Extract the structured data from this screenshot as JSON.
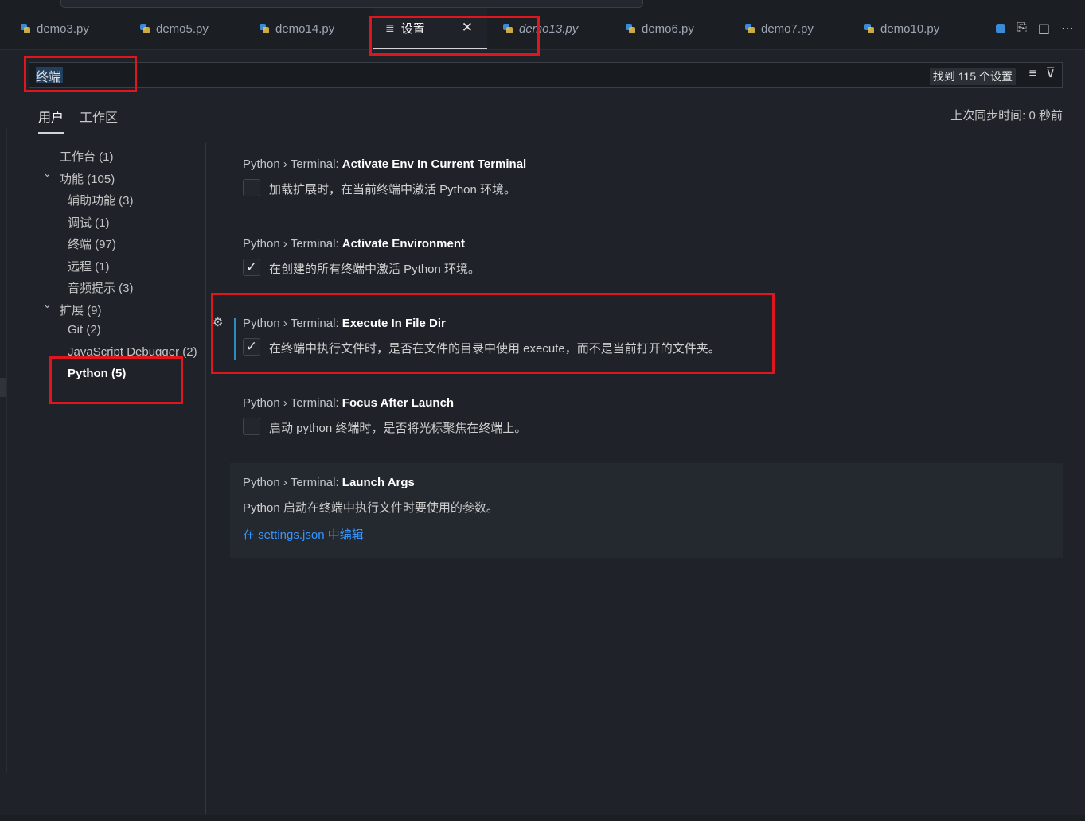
{
  "tabs": [
    {
      "label": "demo3.py",
      "icon": "python-file-icon"
    },
    {
      "label": "demo5.py",
      "icon": "python-file-icon"
    },
    {
      "label": "demo14.py",
      "icon": "python-file-icon"
    },
    {
      "label": "设置",
      "icon": "settings-file-icon",
      "active": true,
      "close": "✕"
    },
    {
      "label": "demo13.py",
      "icon": "python-file-icon",
      "italic": true
    },
    {
      "label": "demo6.py",
      "icon": "python-file-icon"
    },
    {
      "label": "demo7.py",
      "icon": "python-file-icon"
    },
    {
      "label": "demo10.py",
      "icon": "python-file-icon"
    }
  ],
  "search": {
    "value": "终端",
    "result_count": "找到 115 个设置"
  },
  "scope": {
    "user": "用户",
    "workspace": "工作区",
    "sync": "上次同步时间: 0 秒前"
  },
  "toc": [
    {
      "label": "工作台 (1)"
    },
    {
      "label": "功能 (105)",
      "expanded": true
    },
    {
      "label": "辅助功能 (3)"
    },
    {
      "label": "调试 (1)"
    },
    {
      "label": "终端 (97)"
    },
    {
      "label": "远程 (1)"
    },
    {
      "label": "音频提示 (3)"
    },
    {
      "label": "扩展 (9)",
      "expanded": true
    },
    {
      "label": "Git (2)"
    },
    {
      "label": "JavaScript Debugger (2)"
    },
    {
      "label": "Python (5)",
      "selected": true
    }
  ],
  "settings": [
    {
      "prefix": "Python › Terminal: ",
      "name": "Activate Env In Current Terminal",
      "desc": "加载扩展时，在当前终端中激活 Python 环境。",
      "checked": false
    },
    {
      "prefix": "Python › Terminal: ",
      "name": "Activate Environment",
      "desc": "在创建的所有终端中激活 Python 环境。",
      "checked": true
    },
    {
      "prefix": "Python › Terminal: ",
      "name": "Execute In File Dir",
      "desc": "在终端中执行文件时，是否在文件的目录中使用 execute，而不是当前打开的文件夹。",
      "checked": true
    },
    {
      "prefix": "Python › Terminal: ",
      "name": "Focus After Launch",
      "desc": "启动 python 终端时，是否将光标聚焦在终端上。",
      "checked": false
    },
    {
      "prefix": "Python › Terminal: ",
      "name": "Launch Args",
      "desc": "Python 启动在终端中执行文件时要使用的参数。",
      "link": "在 settings.json 中编辑"
    }
  ],
  "icons": {
    "check": "✓",
    "chevron": "⌄",
    "gear": "⚙",
    "clear_filter": "≡",
    "filter": "⊽"
  },
  "colors": {
    "highlight_box": "#e0161f",
    "accent_link": "#3794ff",
    "modified_bar": "#2e8bc0"
  }
}
